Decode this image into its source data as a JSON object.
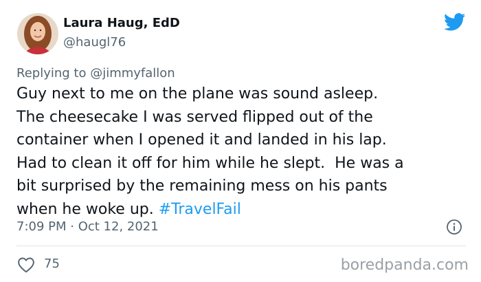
{
  "author": {
    "name": "Laura Haug, EdD",
    "handle": "@haugl76"
  },
  "reply": {
    "prefix": "Replying to ",
    "mention": "@jimmyfallon"
  },
  "tweet": {
    "lines": [
      "Guy next to me on the plane was sound asleep.",
      "The cheesecake I was served flipped out of the",
      "container when I opened it and landed in his lap.",
      "Had to clean it off for him while he slept.  He was a",
      "bit surprised by the remaining mess on his pants",
      "when he woke up. "
    ],
    "hashtag": "#TravelFail"
  },
  "meta": {
    "timestamp": "7:09 PM · Oct 12, 2021"
  },
  "stats": {
    "likes": "75"
  },
  "watermark": "boredpanda.com",
  "colors": {
    "link": "#1d9bf0",
    "twitter_blue": "#1d9bf0",
    "secondary_text": "#536471"
  }
}
